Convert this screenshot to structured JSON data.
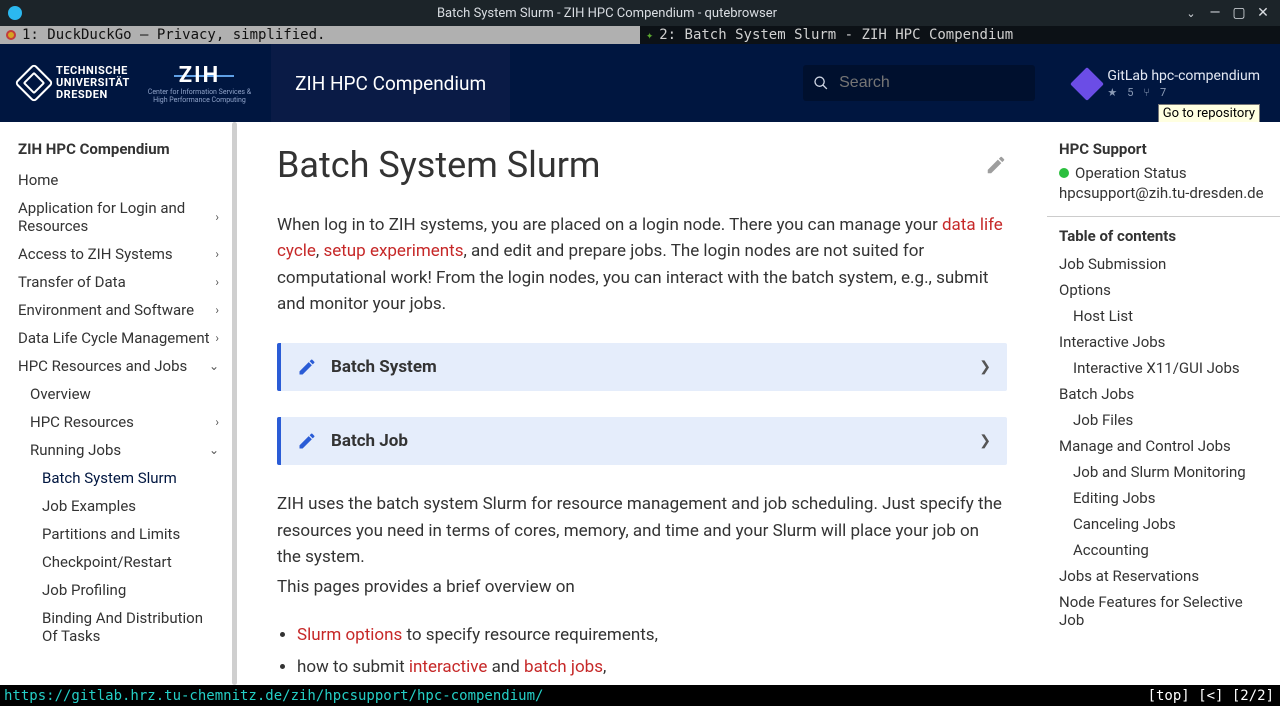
{
  "window": {
    "title": "Batch System Slurm - ZIH HPC Compendium - qutebrowser"
  },
  "tabs": {
    "t1": "1: DuckDuckGo — Privacy, simplified.",
    "t2": "2: Batch System Slurm - ZIH HPC Compendium"
  },
  "header": {
    "tud_line1": "TECHNISCHE",
    "tud_line2": "UNIVERSITÄT",
    "tud_line3": "DRESDEN",
    "zih": "ZIH",
    "zih_sub1": "Center for Information Services &",
    "zih_sub2": "High Performance Computing",
    "site_title": "ZIH HPC Compendium",
    "search_placeholder": "Search",
    "repo_label": "GitLab hpc-compendium",
    "repo_stars": "5",
    "repo_forks": "7",
    "tooltip": "Go to repository"
  },
  "left_nav": {
    "title": "ZIH HPC Compendium",
    "items": [
      {
        "label": "Home",
        "chev": false,
        "indent": 0
      },
      {
        "label": "Application for Login and Resources",
        "chev": true,
        "indent": 0
      },
      {
        "label": "Access to ZIH Systems",
        "chev": true,
        "indent": 0
      },
      {
        "label": "Transfer of Data",
        "chev": true,
        "indent": 0
      },
      {
        "label": "Environment and Software",
        "chev": true,
        "indent": 0
      },
      {
        "label": "Data Life Cycle Management",
        "chev": true,
        "indent": 0
      },
      {
        "label": "HPC Resources and Jobs",
        "chev": "down",
        "indent": 0
      },
      {
        "label": "Overview",
        "chev": false,
        "indent": 1
      },
      {
        "label": "HPC Resources",
        "chev": true,
        "indent": 1
      },
      {
        "label": "Running Jobs",
        "chev": "down",
        "indent": 1
      },
      {
        "label": "Batch System Slurm",
        "chev": false,
        "indent": 2,
        "active": true
      },
      {
        "label": "Job Examples",
        "chev": false,
        "indent": 2
      },
      {
        "label": "Partitions and Limits",
        "chev": false,
        "indent": 2
      },
      {
        "label": "Checkpoint/Restart",
        "chev": false,
        "indent": 2
      },
      {
        "label": "Job Profiling",
        "chev": false,
        "indent": 2
      },
      {
        "label": "Binding And Distribution Of Tasks",
        "chev": false,
        "indent": 2
      }
    ]
  },
  "article": {
    "h1": "Batch System Slurm",
    "p1_a": "When log in to ZIH systems, you are placed on a login node. There you can manage your ",
    "p1_link1": "data life cycle",
    "p1_b": ", ",
    "p1_link2": "setup experiments",
    "p1_c": ", and edit and prepare jobs. The login nodes are not suited for computational work! From the login nodes, you can interact with the batch system, e.g., submit and monitor your jobs.",
    "admon1": "Batch System",
    "admon2": "Batch Job",
    "p2": "ZIH uses the batch system Slurm for resource management and job scheduling. Just specify the resources you need in terms of cores, memory, and time and your Slurm will place your job on the system.",
    "p3": "This pages provides a brief overview on",
    "li1_link": "Slurm options",
    "li1_tail": " to specify resource requirements,",
    "li2_a": "how to submit ",
    "li2_link1": "interactive",
    "li2_b": " and ",
    "li2_link2": "batch jobs",
    "li2_c": ","
  },
  "right": {
    "support_h": "HPC Support",
    "status": "Operation Status",
    "email": "hpcsupport@zih.tu-dresden.de",
    "toc_h": "Table of contents",
    "toc": [
      {
        "label": "Job Submission",
        "indent": 0
      },
      {
        "label": "Options",
        "indent": 0
      },
      {
        "label": "Host List",
        "indent": 1
      },
      {
        "label": "Interactive Jobs",
        "indent": 0
      },
      {
        "label": "Interactive X11/GUI Jobs",
        "indent": 1
      },
      {
        "label": "Batch Jobs",
        "indent": 0
      },
      {
        "label": "Job Files",
        "indent": 1
      },
      {
        "label": "Manage and Control Jobs",
        "indent": 0
      },
      {
        "label": "Job and Slurm Monitoring",
        "indent": 1
      },
      {
        "label": "Editing Jobs",
        "indent": 1
      },
      {
        "label": "Canceling Jobs",
        "indent": 1
      },
      {
        "label": "Accounting",
        "indent": 1
      },
      {
        "label": "Jobs at Reservations",
        "indent": 0
      },
      {
        "label": "Node Features for Selective Job",
        "indent": 0
      }
    ]
  },
  "status": {
    "url": "https://gitlab.hrz.tu-chemnitz.de/zih/hpcsupport/hpc-compendium/",
    "pos": "[top] [<] [2/2]"
  }
}
